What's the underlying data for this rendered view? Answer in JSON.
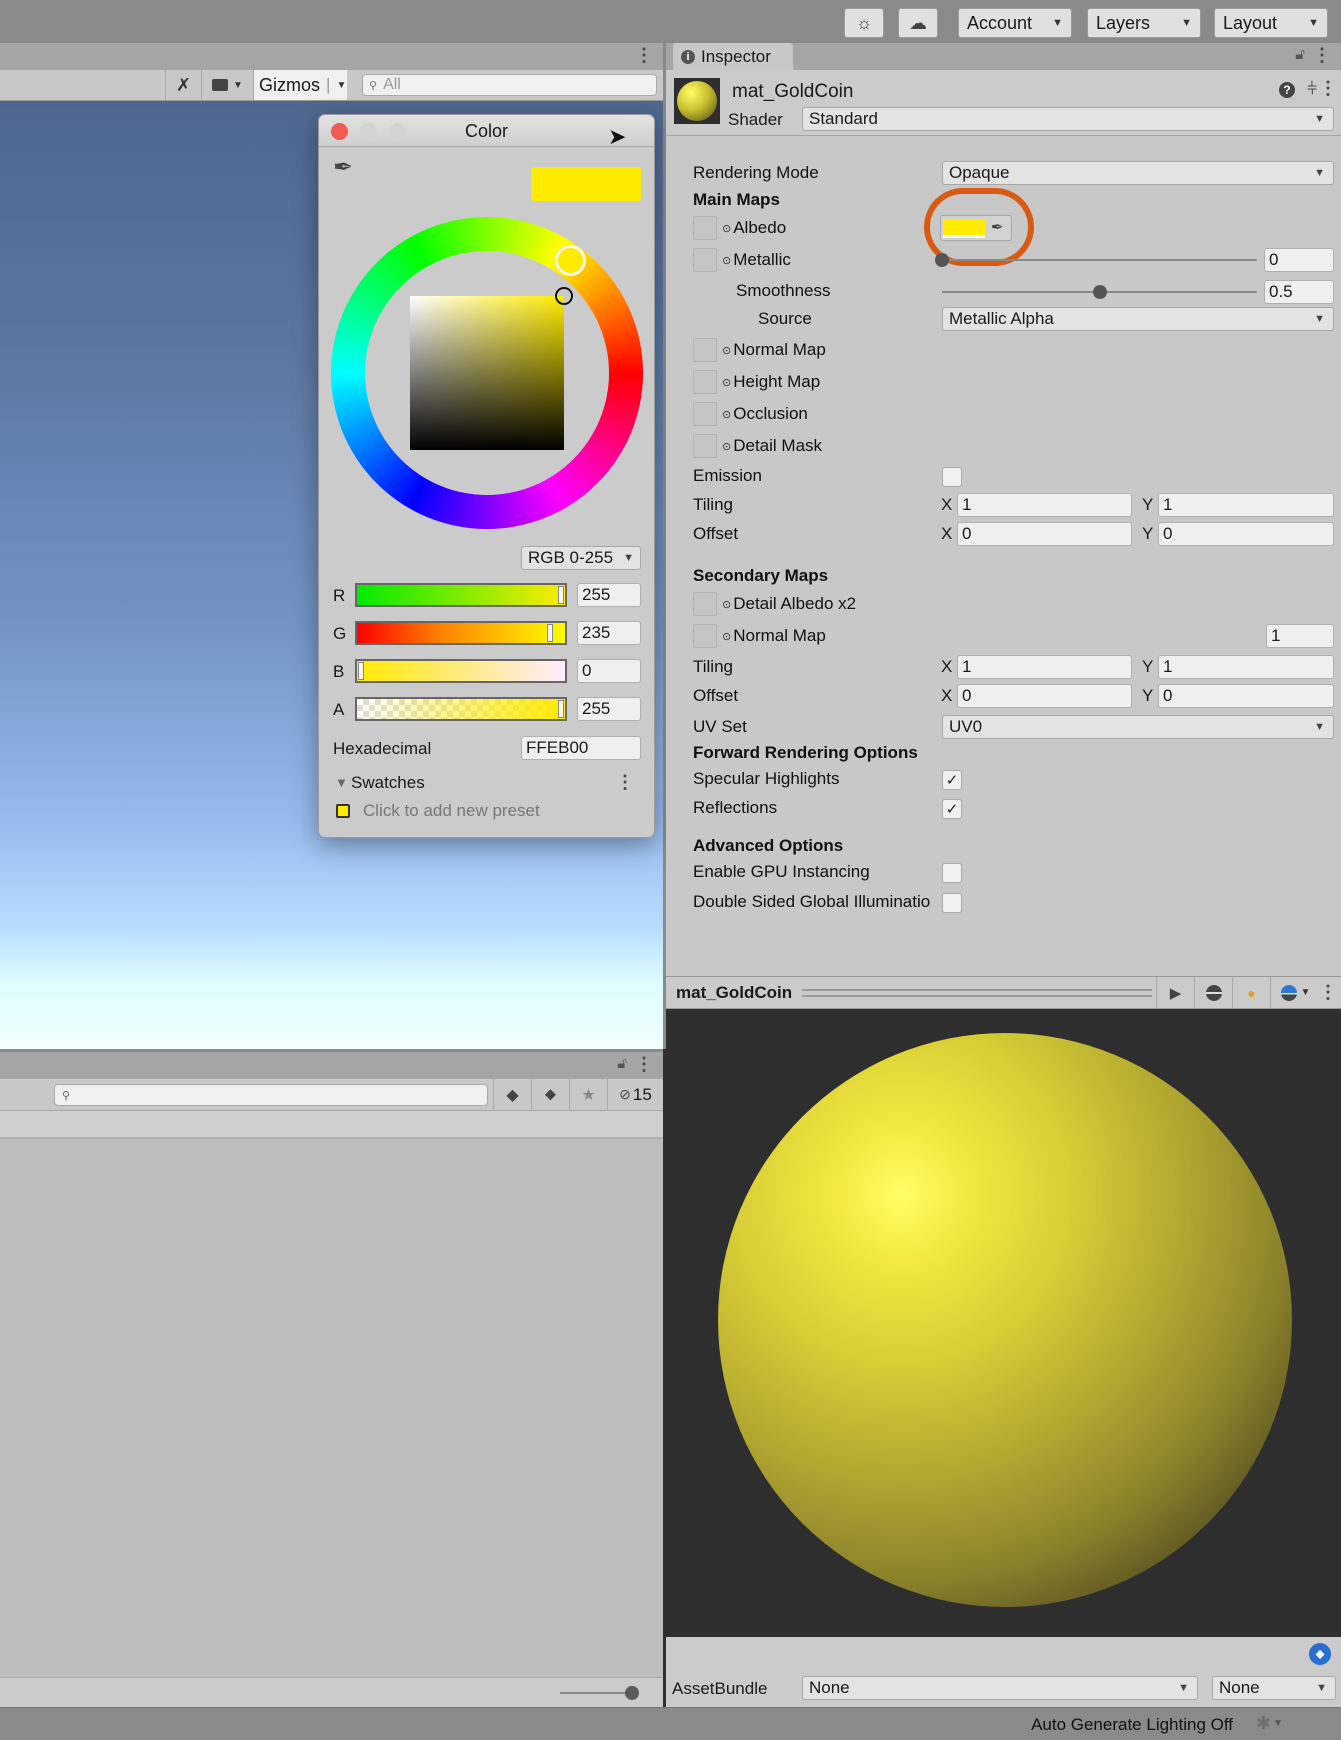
{
  "toolbar": {
    "buttons": [
      {
        "name": "lighting-icon-button",
        "icon": "sun-dots-icon"
      },
      {
        "name": "cloud-button",
        "icon": "cloud-icon"
      }
    ],
    "account_label": "Account",
    "layers_label": "Layers",
    "layout_label": "Layout"
  },
  "scene": {
    "gizmos_label": "Gizmos",
    "search_placeholder": "All"
  },
  "project": {
    "hidden_count": "15"
  },
  "color_picker": {
    "title": "Color",
    "current_color": "#FFEB00",
    "mode_label": "RGB 0-255",
    "channels": [
      {
        "label": "R",
        "value": "255"
      },
      {
        "label": "G",
        "value": "235"
      },
      {
        "label": "B",
        "value": "0"
      },
      {
        "label": "A",
        "value": "255"
      }
    ],
    "hex_label": "Hexadecimal",
    "hex_value": "FFEB00",
    "swatches_label": "Swatches",
    "add_preset_label": "Click to add new preset"
  },
  "inspector": {
    "tab_label": "Inspector",
    "material_name": "mat_GoldCoin",
    "shader_label": "Shader",
    "shader_value": "Standard",
    "rendering_mode_label": "Rendering Mode",
    "rendering_mode_value": "Opaque",
    "main_maps_label": "Main Maps",
    "albedo_label": "Albedo",
    "albedo_color": "#FFEB00",
    "metallic_label": "Metallic",
    "metallic_value": "0",
    "smoothness_label": "Smoothness",
    "smoothness_value": "0.5",
    "source_label": "Source",
    "source_value": "Metallic Alpha",
    "texture_slots": [
      "Normal Map",
      "Height Map",
      "Occlusion",
      "Detail Mask"
    ],
    "emission_label": "Emission",
    "tiling_label": "Tiling",
    "offset_label": "Offset",
    "main_tiling": {
      "x": "1",
      "y": "1"
    },
    "main_offset": {
      "x": "0",
      "y": "0"
    },
    "secondary_maps_label": "Secondary Maps",
    "detail_albedo_label": "Detail Albedo x2",
    "secondary_normal_label": "Normal Map",
    "secondary_normal_value": "1",
    "secondary_tiling": {
      "x": "1",
      "y": "1"
    },
    "secondary_offset": {
      "x": "0",
      "y": "0"
    },
    "uv_set_label": "UV Set",
    "uv_set_value": "UV0",
    "forward_label": "Forward Rendering Options",
    "specular_label": "Specular Highlights",
    "specular_checked": true,
    "reflections_label": "Reflections",
    "reflections_checked": true,
    "advanced_label": "Advanced Options",
    "gpu_instancing_label": "Enable GPU Instancing",
    "gpu_instancing_checked": false,
    "double_sided_label": "Double Sided Global Illuminatio",
    "double_sided_checked": false,
    "x_label": "X",
    "y_label": "Y"
  },
  "preview": {
    "title": "mat_GoldCoin"
  },
  "assetbundle": {
    "label": "AssetBundle",
    "name_value": "None",
    "variant_value": "None"
  },
  "status": {
    "lighting_text": "Auto Generate Lighting Off"
  }
}
